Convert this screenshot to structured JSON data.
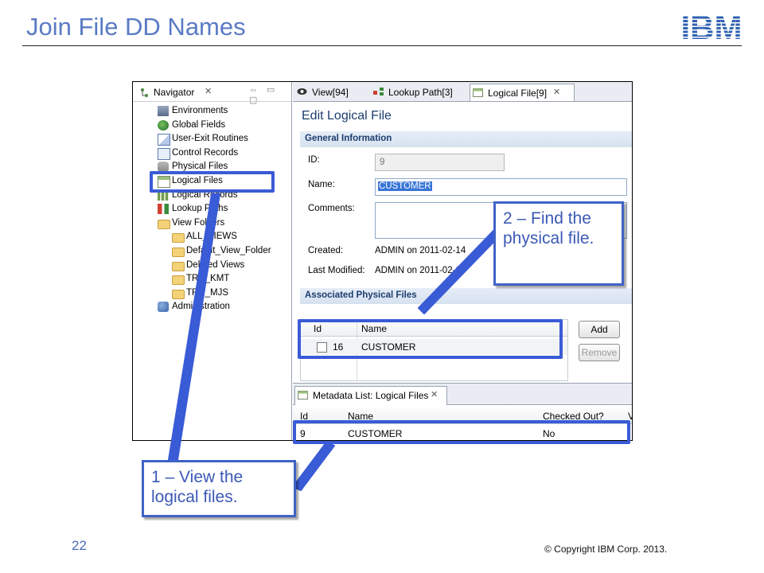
{
  "slide": {
    "title": "Join File DD Names",
    "page_number": "22",
    "copyright": "© Copyright  IBM Corp. 2013.",
    "logo_text": "IBM"
  },
  "navigator": {
    "tab_label": "Navigator",
    "items": [
      {
        "label": "Environments",
        "icon": "environments-icon"
      },
      {
        "label": "Global Fields",
        "icon": "globe-icon"
      },
      {
        "label": "User-Exit Routines",
        "icon": "user-exit-icon"
      },
      {
        "label": "Control Records",
        "icon": "control-records-icon"
      },
      {
        "label": "Physical Files",
        "icon": "physical-files-icon"
      },
      {
        "label": "Logical Files",
        "icon": "logical-files-icon"
      },
      {
        "label": "Logical Records",
        "icon": "logical-records-icon"
      },
      {
        "label": "Lookup Paths",
        "icon": "lookup-paths-icon"
      },
      {
        "label": "View Folders",
        "icon": "folder-icon"
      },
      {
        "label": "ALL_VIEWS",
        "icon": "folder-icon"
      },
      {
        "label": "Default_View_Folder",
        "icon": "folder-icon"
      },
      {
        "label": "Deleted Views",
        "icon": "folder-icon"
      },
      {
        "label": "TRN_KMT",
        "icon": "folder-icon"
      },
      {
        "label": "TRN_MJS",
        "icon": "folder-icon"
      },
      {
        "label": "Administration",
        "icon": "administration-icon"
      }
    ]
  },
  "editor_tabs": [
    {
      "label": "View[94]",
      "icon": "view-icon"
    },
    {
      "label": "Lookup Path[3]",
      "icon": "lookup-path-icon"
    },
    {
      "label": "Logical File[9]",
      "icon": "logical-file-icon"
    }
  ],
  "editor": {
    "title": "Edit Logical File",
    "general_section": "General Information",
    "id_label": "ID:",
    "id_value": "9",
    "name_label": "Name:",
    "name_value": "CUSTOMER",
    "comments_label": "Comments:",
    "created_label": "Created:",
    "created_value": "ADMIN on 2011-02-14",
    "modified_label": "Last Modified:",
    "modified_value": "ADMIN on 2011-02-1",
    "physical_section": "Associated Physical Files",
    "grid_headers": [
      "Id",
      "Name"
    ],
    "grid_rows": [
      {
        "id": "16",
        "name": "CUSTOMER"
      }
    ],
    "add_button": "Add",
    "remove_button": "Remove"
  },
  "metadata": {
    "tab_label": "Metadata List: Logical Files",
    "headers": [
      "Id",
      "Name",
      "Checked Out?",
      "V"
    ],
    "rows": [
      {
        "id": "9",
        "name": "CUSTOMER",
        "checked_out": "No"
      }
    ]
  },
  "callouts": {
    "step1": "1 – View the logical files.",
    "step2": "2 – Find the physical file."
  },
  "colors": {
    "title": "#5a7bc4",
    "callout_border": "#3f63c7",
    "highlight": "#3a5bd6"
  }
}
